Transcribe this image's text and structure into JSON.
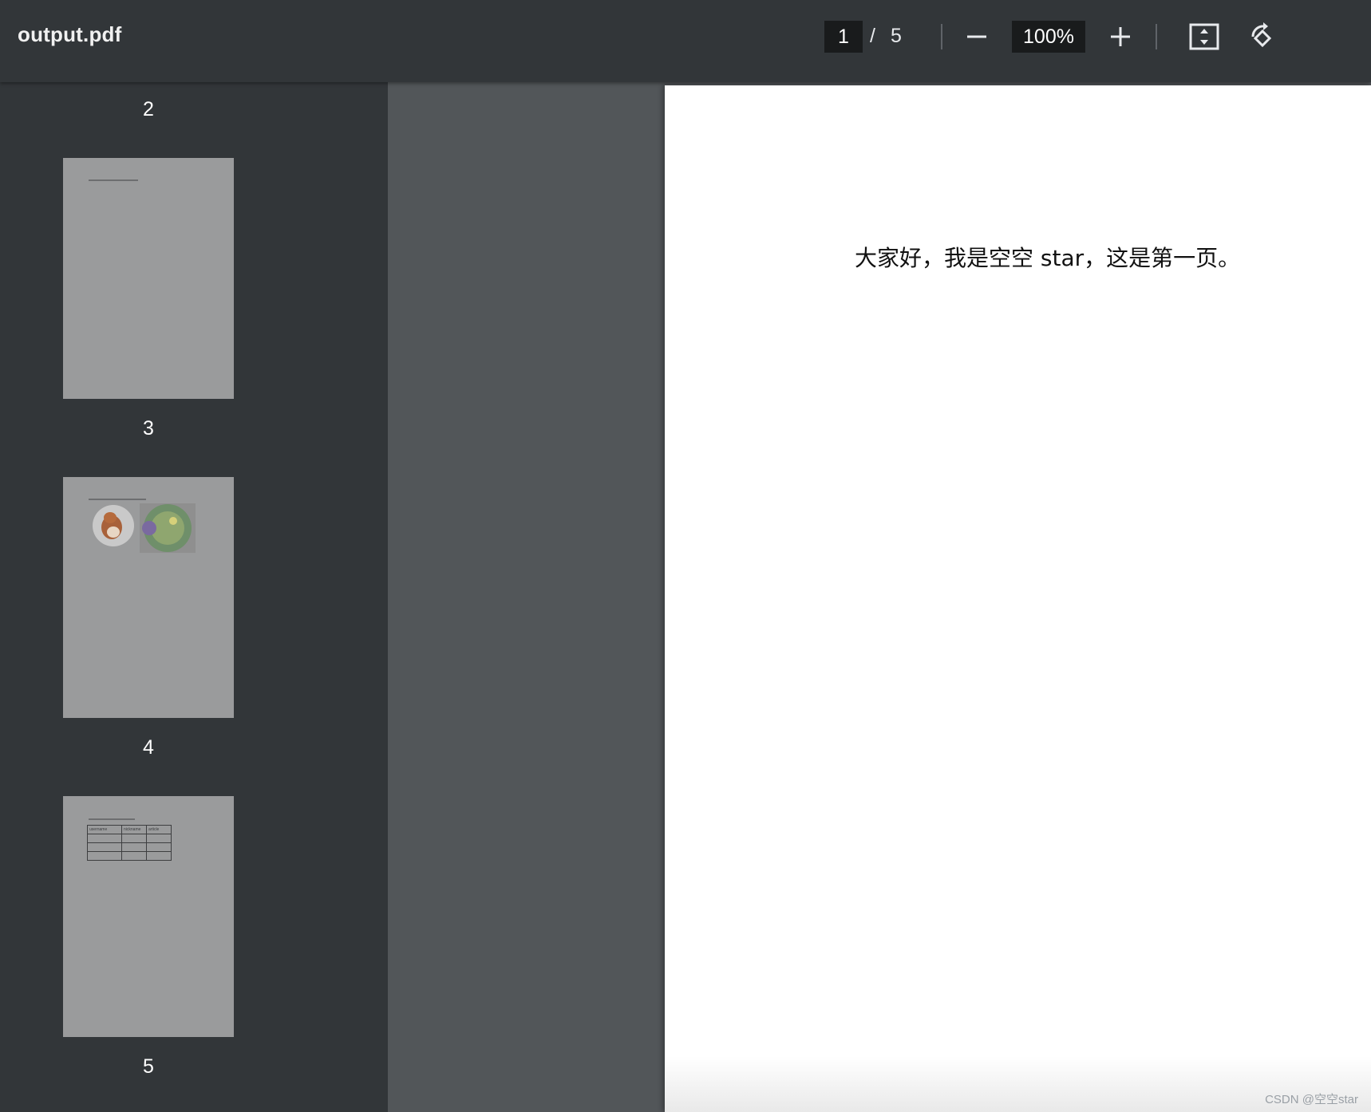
{
  "toolbar": {
    "title": "output.pdf",
    "current_page": "1",
    "page_separator": "/",
    "total_pages": "5",
    "zoom": "100%",
    "icons": [
      "minus-icon",
      "plus-icon",
      "fit-page-icon",
      "rotate-icon"
    ]
  },
  "sidebar": {
    "thumbnails": [
      {
        "number": "2"
      },
      {
        "number": "3"
      },
      {
        "number": "4"
      },
      {
        "number": "5"
      }
    ],
    "thumb5_table": {
      "headers": [
        "username",
        "nickname",
        "article"
      ]
    }
  },
  "page": {
    "text": "大家好，我是空空 star，这是第一页。"
  },
  "watermark": "CSDN @空空star",
  "colors": {
    "toolbar_bg": "#323639",
    "viewer_bg": "#525659",
    "thumb_bg": "#9a9b9c",
    "page_bg": "#ffffff"
  }
}
